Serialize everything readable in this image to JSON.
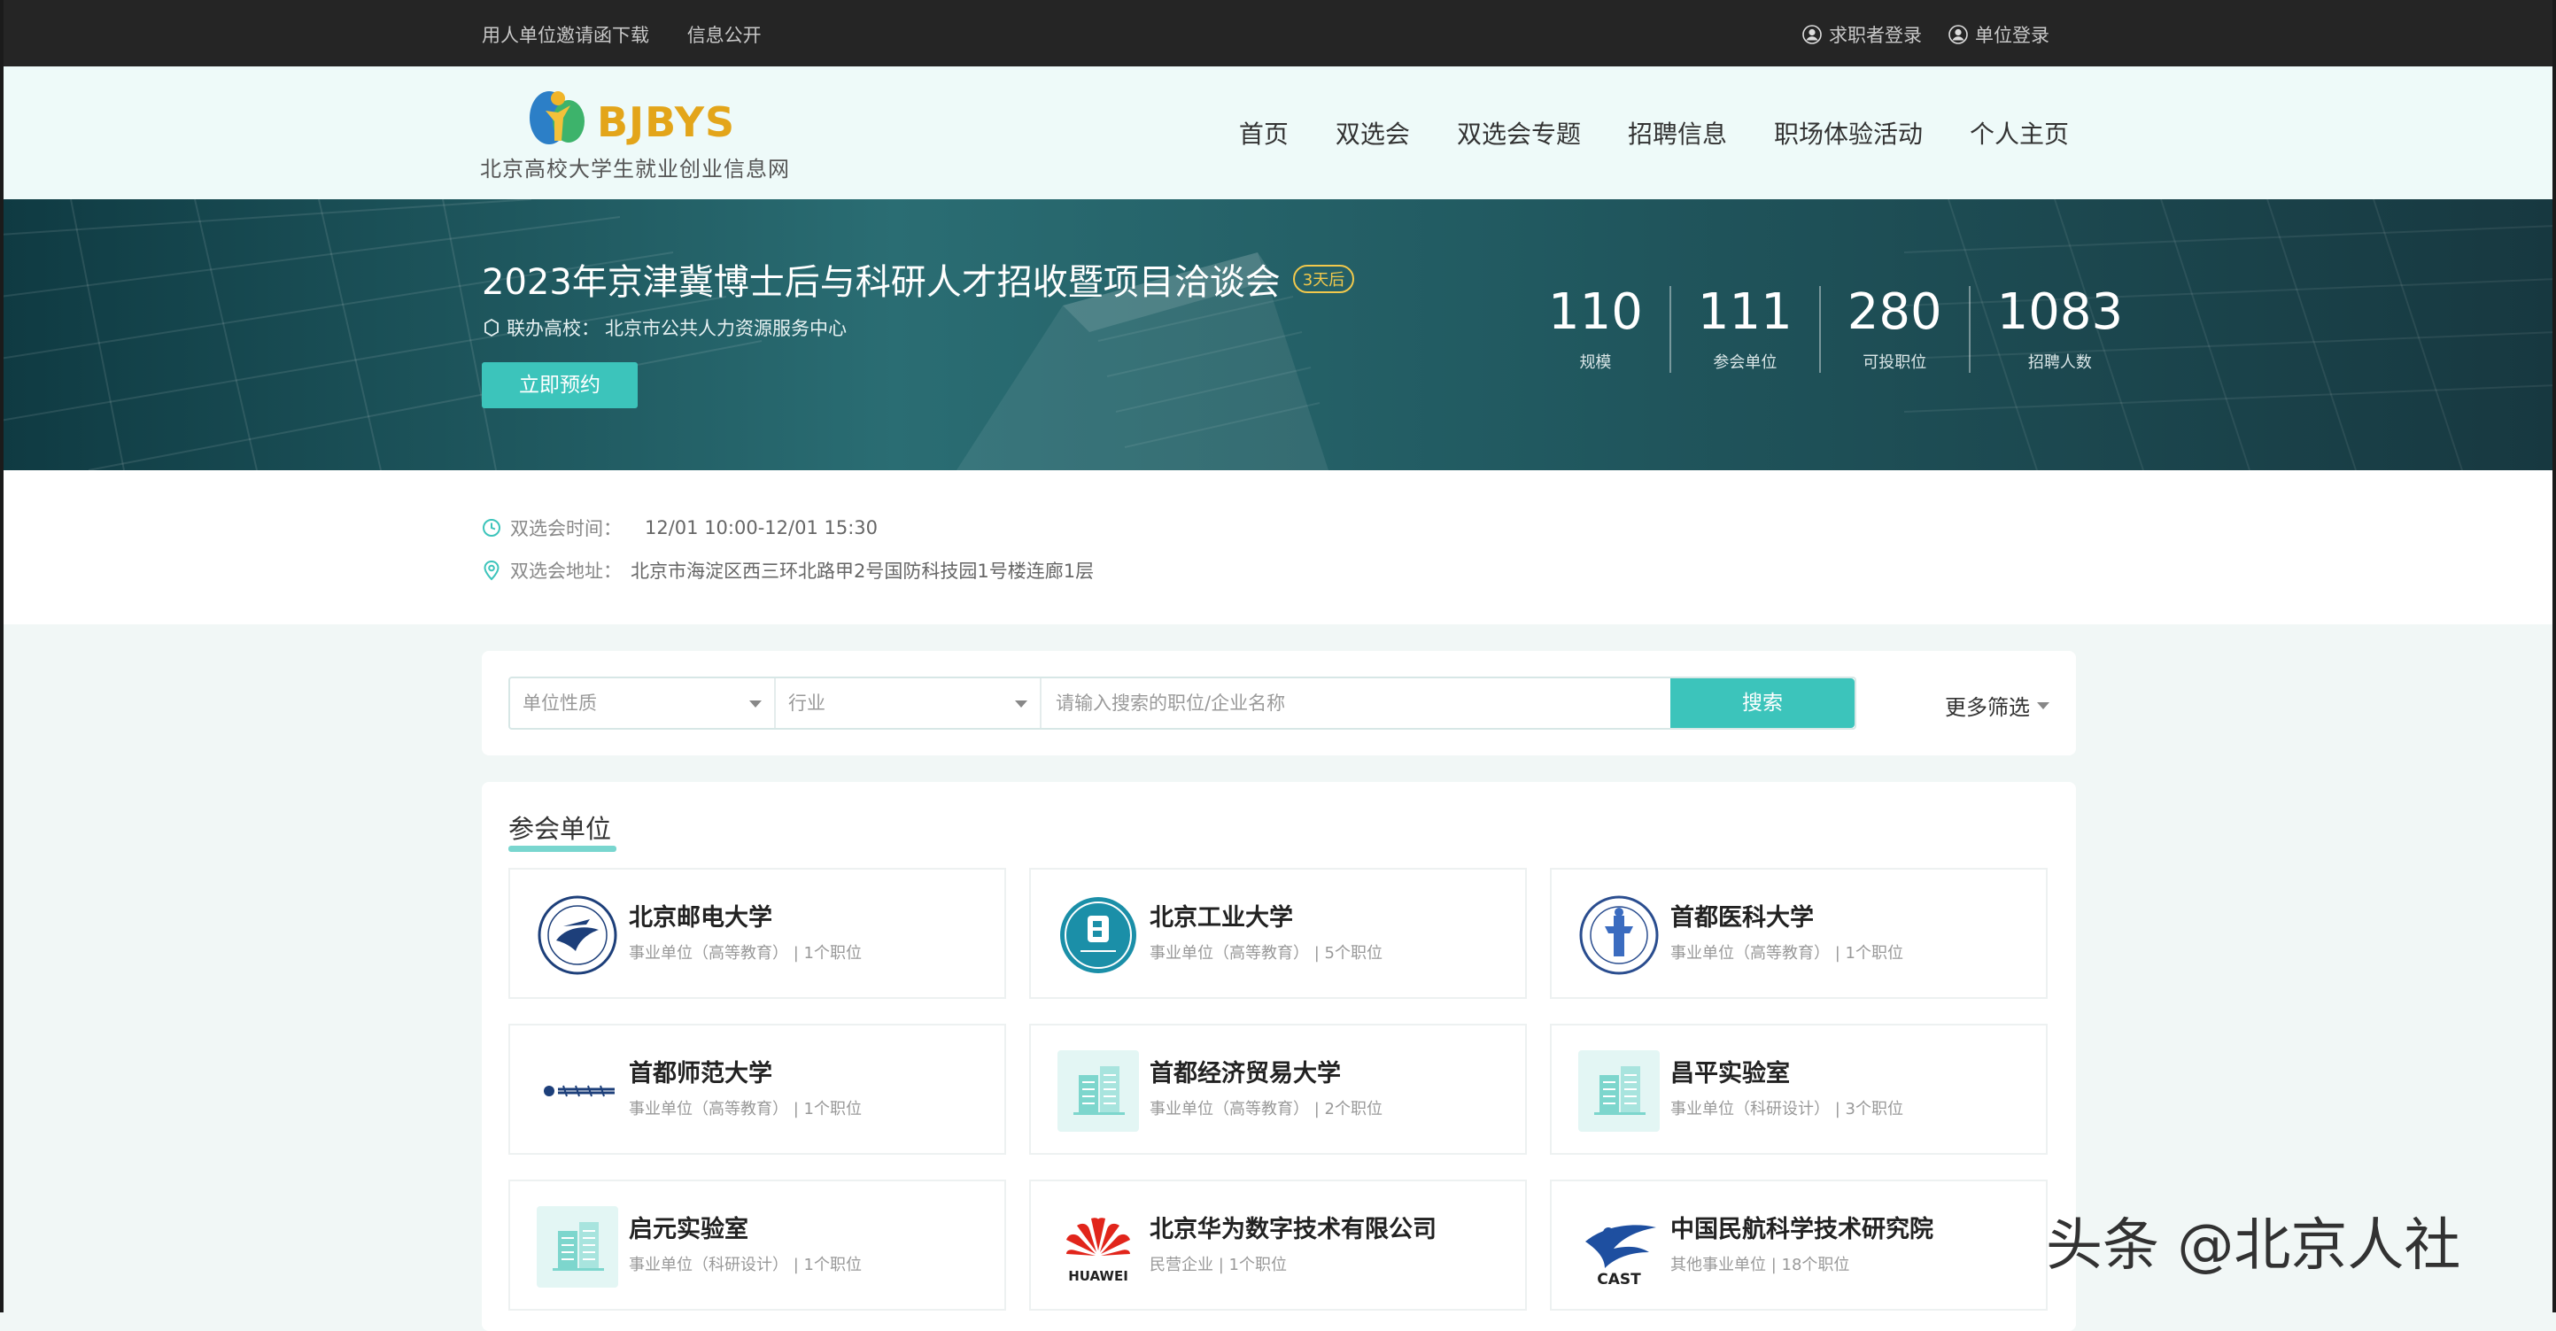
{
  "topbar": {
    "links": [
      "用人单位邀请函下载",
      "信息公开"
    ],
    "seeker_login": "求职者登录",
    "company_login": "单位登录"
  },
  "header": {
    "logo_brand": "BJBYS",
    "logo_sub": "北京高校大学生就业创业信息网",
    "nav": [
      "首页",
      "双选会",
      "双选会专题",
      "招聘信息",
      "职场体验活动",
      "个人主页"
    ]
  },
  "banner": {
    "title": "2023年京津冀博士后与科研人才招收暨项目洽谈会",
    "badge": "3天后",
    "co_label": "联办高校：",
    "co_value": "北京市公共人力资源服务中心",
    "button": "立即预约",
    "stats": [
      {
        "value": "110",
        "label": "规模"
      },
      {
        "value": "111",
        "label": "参会单位"
      },
      {
        "value": "280",
        "label": "可投职位"
      },
      {
        "value": "1083",
        "label": "招聘人数"
      }
    ]
  },
  "info": {
    "time_label": "双选会时间：",
    "time_value": "12/01 10:00-12/01 15:30",
    "addr_label": "双选会地址：",
    "addr_value": "北京市海淀区西三环北路甲2号国防科技园1号楼连廊1层"
  },
  "search": {
    "unit_type_placeholder": "单位性质",
    "industry_placeholder": "行业",
    "input_placeholder": "请输入搜索的职位/企业名称",
    "button": "搜索",
    "more": "更多筛选"
  },
  "companies": {
    "title": "参会单位",
    "items": [
      {
        "name": "北京邮电大学",
        "meta": "事业单位（高等教育） | 1个职位",
        "logo": "bupt-logo"
      },
      {
        "name": "北京工业大学",
        "meta": "事业单位（高等教育） | 5个职位",
        "logo": "bjut-logo"
      },
      {
        "name": "首都医科大学",
        "meta": "事业单位（高等教育） | 1个职位",
        "logo": "ccmu-logo"
      },
      {
        "name": "首都师范大学",
        "meta": "事业单位（高等教育） | 1个职位",
        "logo": "cnu-logo"
      },
      {
        "name": "首都经济贸易大学",
        "meta": "事业单位（高等教育） | 2个职位",
        "logo": "building-icon"
      },
      {
        "name": "昌平实验室",
        "meta": "事业单位（科研设计） | 3个职位",
        "logo": "building-icon"
      },
      {
        "name": "启元实验室",
        "meta": "事业单位（科研设计） | 1个职位",
        "logo": "building-icon"
      },
      {
        "name": "北京华为数字技术有限公司",
        "meta": "民营企业 | 1个职位",
        "logo": "huawei-logo"
      },
      {
        "name": "中国民航科学技术研究院",
        "meta": "其他事业单位 | 18个职位",
        "logo": "cast-logo"
      }
    ]
  },
  "watermark": "头条 @北京人社",
  "colors": {
    "accent": "#3cc4bb",
    "badge": "#f2c94c",
    "topbar": "#252525",
    "header_bg": "#eefaf9"
  }
}
